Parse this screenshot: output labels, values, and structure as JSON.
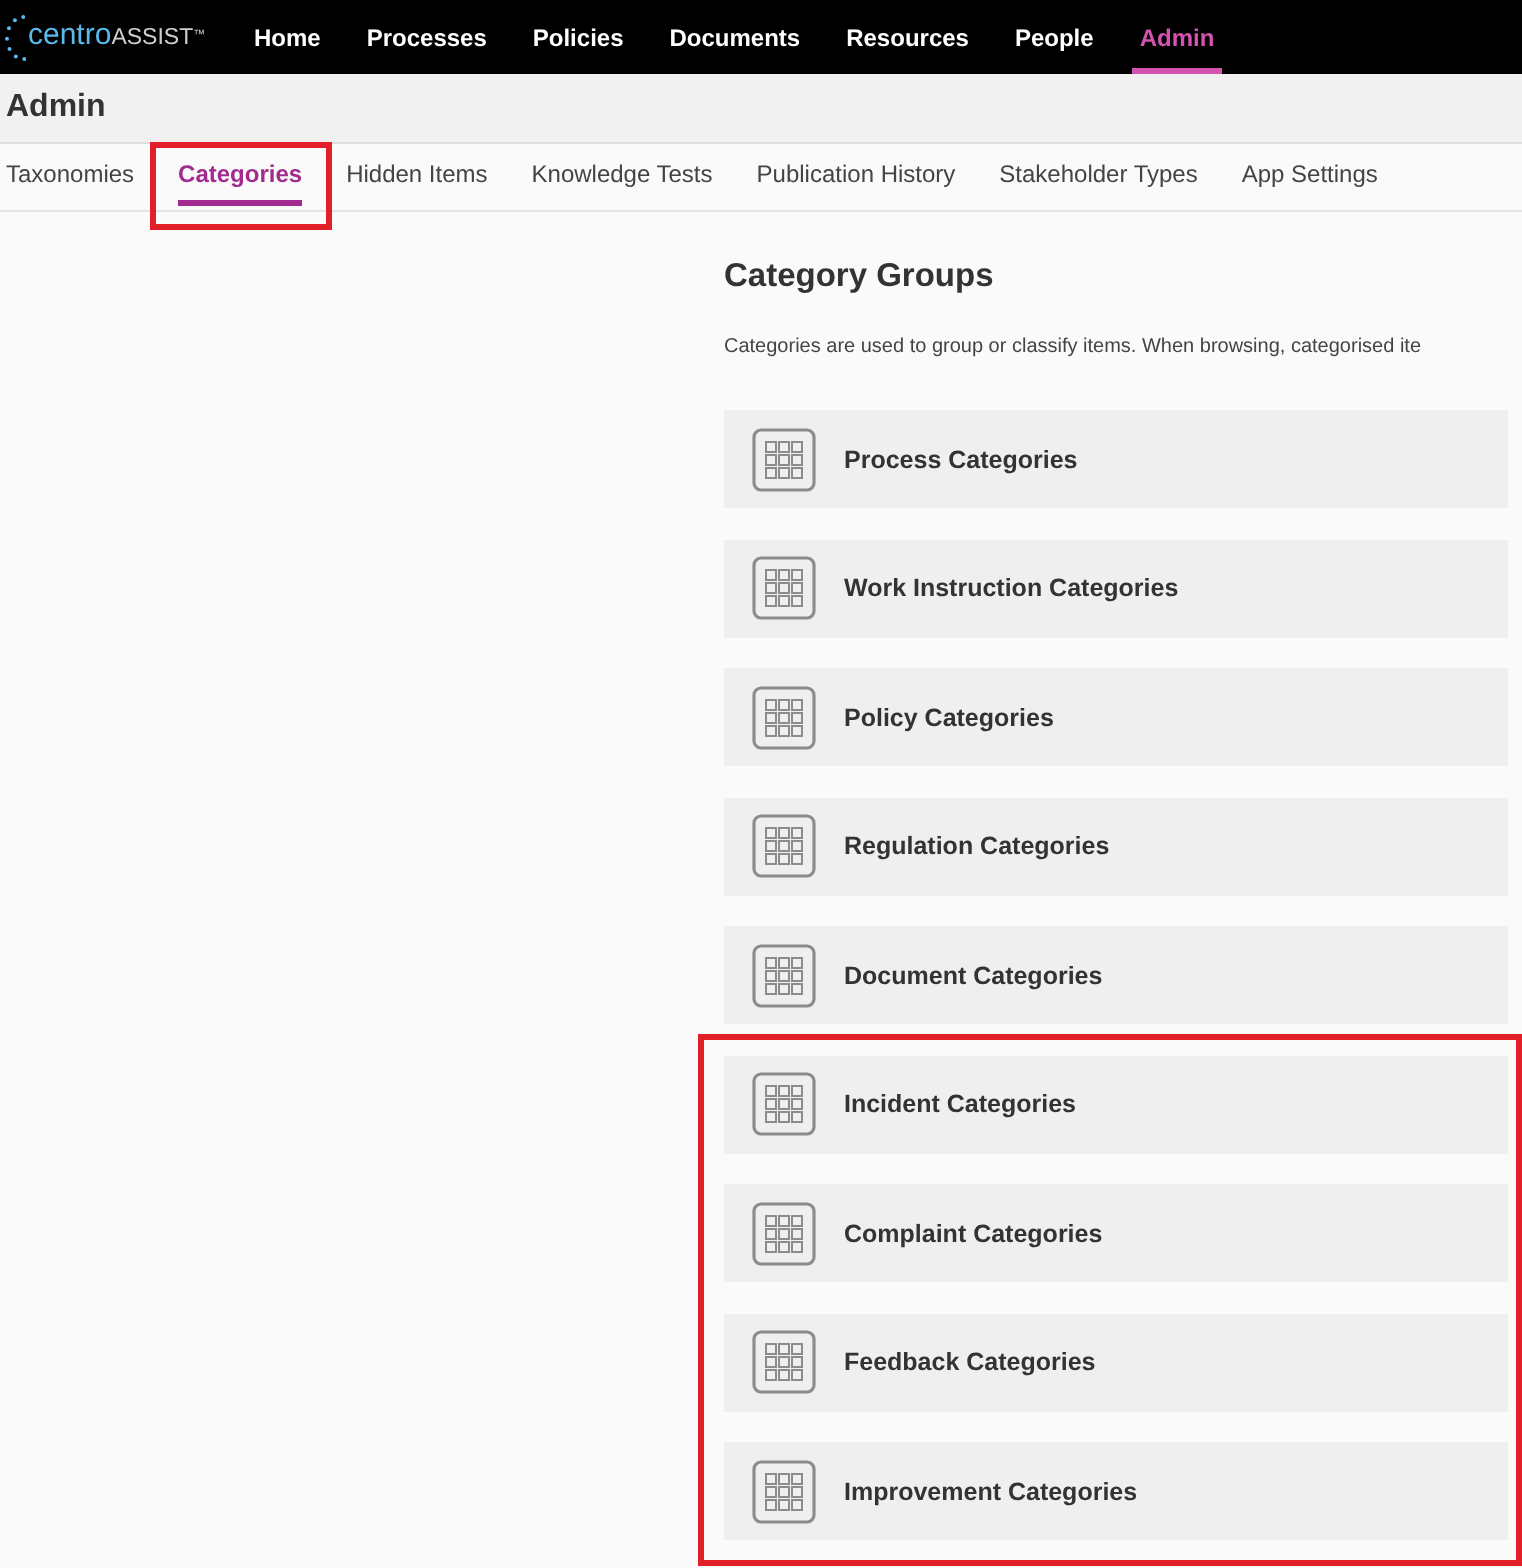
{
  "logo": {
    "word": "centro",
    "suffix": "ASSIST",
    "mark": "™"
  },
  "nav": [
    {
      "label": "Home",
      "selected": false
    },
    {
      "label": "Processes",
      "selected": false
    },
    {
      "label": "Policies",
      "selected": false
    },
    {
      "label": "Documents",
      "selected": false
    },
    {
      "label": "Resources",
      "selected": false
    },
    {
      "label": "People",
      "selected": false
    },
    {
      "label": "Admin",
      "selected": true
    }
  ],
  "page_title": "Admin",
  "tabs": [
    {
      "label": "Taxonomies",
      "selected": false,
      "highlighted": false
    },
    {
      "label": "Categories",
      "selected": true,
      "highlighted": true
    },
    {
      "label": "Hidden Items",
      "selected": false,
      "highlighted": false
    },
    {
      "label": "Knowledge Tests",
      "selected": false,
      "highlighted": false
    },
    {
      "label": "Publication History",
      "selected": false,
      "highlighted": false
    },
    {
      "label": "Stakeholder Types",
      "selected": false,
      "highlighted": false
    },
    {
      "label": "App Settings",
      "selected": false,
      "highlighted": false
    }
  ],
  "section": {
    "title": "Category Groups",
    "description": "Categories are used to group or classify items. When browsing, categorised ite"
  },
  "card_groups": [
    {
      "highlighted": false,
      "cards": [
        {
          "label": "Process Categories"
        },
        {
          "label": "Work Instruction Categories"
        },
        {
          "label": "Policy Categories"
        },
        {
          "label": "Regulation Categories"
        },
        {
          "label": "Document Categories"
        }
      ]
    },
    {
      "highlighted": true,
      "cards": [
        {
          "label": "Incident Categories"
        },
        {
          "label": "Complaint Categories"
        },
        {
          "label": "Feedback Categories"
        },
        {
          "label": "Improvement Categories"
        }
      ]
    }
  ]
}
